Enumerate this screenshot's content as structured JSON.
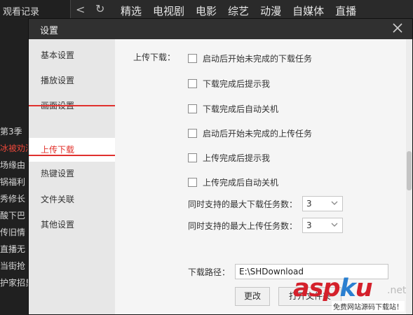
{
  "background": {
    "history_title": "观看记录",
    "nav": [
      "精选",
      "电视剧",
      "电影",
      "综艺",
      "动漫",
      "自媒体",
      "直播"
    ],
    "list_items": [
      "第3季",
      "冰被劝酒",
      "场缘由",
      "锅福利",
      "秀修长",
      "酸下巴",
      "传旧情",
      "直播无",
      "当街抢",
      "护家招臭"
    ],
    "highlight_index": 1
  },
  "dialog": {
    "title": "设置",
    "sidebar": {
      "items": [
        "基本设置",
        "播放设置",
        "画面设置",
        "上传下载",
        "热键设置",
        "文件关联",
        "其他设置"
      ],
      "active_index": 3
    },
    "content": {
      "section_label": "上传下载：",
      "checkboxes": [
        {
          "label": "启动后开始未完成的下载任务",
          "checked": false
        },
        {
          "label": "下载完成后提示我",
          "checked": false
        },
        {
          "label": "下载完成后自动关机",
          "checked": false
        },
        {
          "label": "启动后开始未完成的上传任务",
          "checked": false
        },
        {
          "label": "上传完成后提示我",
          "checked": false
        },
        {
          "label": "上传完成后自动关机",
          "checked": false
        }
      ],
      "max_download": {
        "label": "同时支持的最大下载任务数：",
        "value": "3"
      },
      "max_upload": {
        "label": "同时支持的最大上传任务数：",
        "value": "3"
      },
      "download_path": {
        "label": "下载路径：",
        "value": "E:\\SHDownload"
      },
      "buttons": {
        "change": "更改",
        "open_folder": "打开文件夹"
      }
    }
  },
  "watermark": {
    "logo_a": "asp",
    "logo_k": "k",
    "logo_u": "u",
    "suffix": ".net",
    "subtitle": "免费网站源码下载站！"
  },
  "colors": {
    "accent": "#e1302a",
    "titlebar": "#303030",
    "sidebar": "#e7e7e7",
    "content": "#f5f5f5"
  }
}
